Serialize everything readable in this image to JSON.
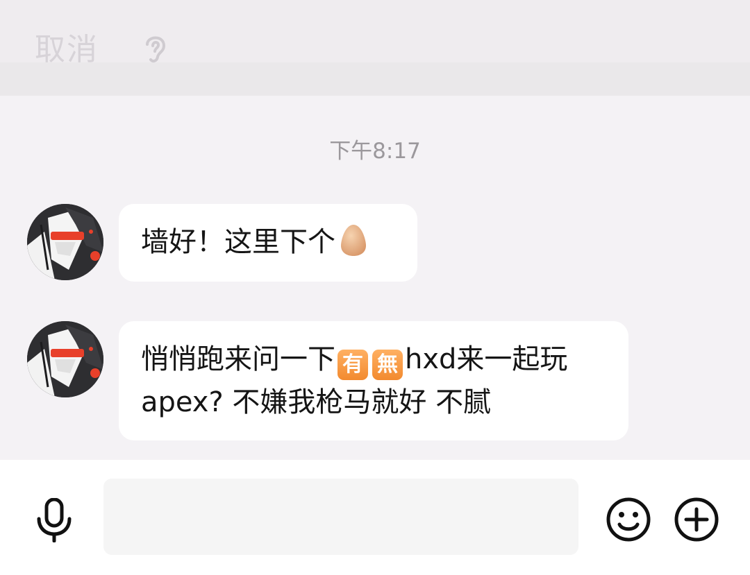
{
  "header": {
    "cancel_label": "取消",
    "ear_icon": "ear-icon"
  },
  "chat": {
    "timestamp": "下午8:17",
    "messages": [
      {
        "sender": "other",
        "avatar_icon": "user-avatar",
        "text": "墙好！这里下个",
        "emoji": "egg"
      },
      {
        "sender": "other",
        "avatar_icon": "user-avatar",
        "text_part1": "悄悄跑来问一下",
        "kanji_emoji_1": "有",
        "kanji_emoji_2": "無",
        "text_part2": "hxd来一起玩apex? 不嫌我枪马就好 不腻"
      }
    ]
  },
  "input_bar": {
    "mic_icon": "microphone-icon",
    "input_value": "",
    "emoji_icon": "smiley-icon",
    "plus_icon": "plus-circle-icon"
  },
  "colors": {
    "background": "#f4f2f5",
    "bubble": "#ffffff",
    "timestamp": "#9b989c",
    "cancel": "#d7d3d8",
    "kanji_emoji": "#f28a2f"
  }
}
